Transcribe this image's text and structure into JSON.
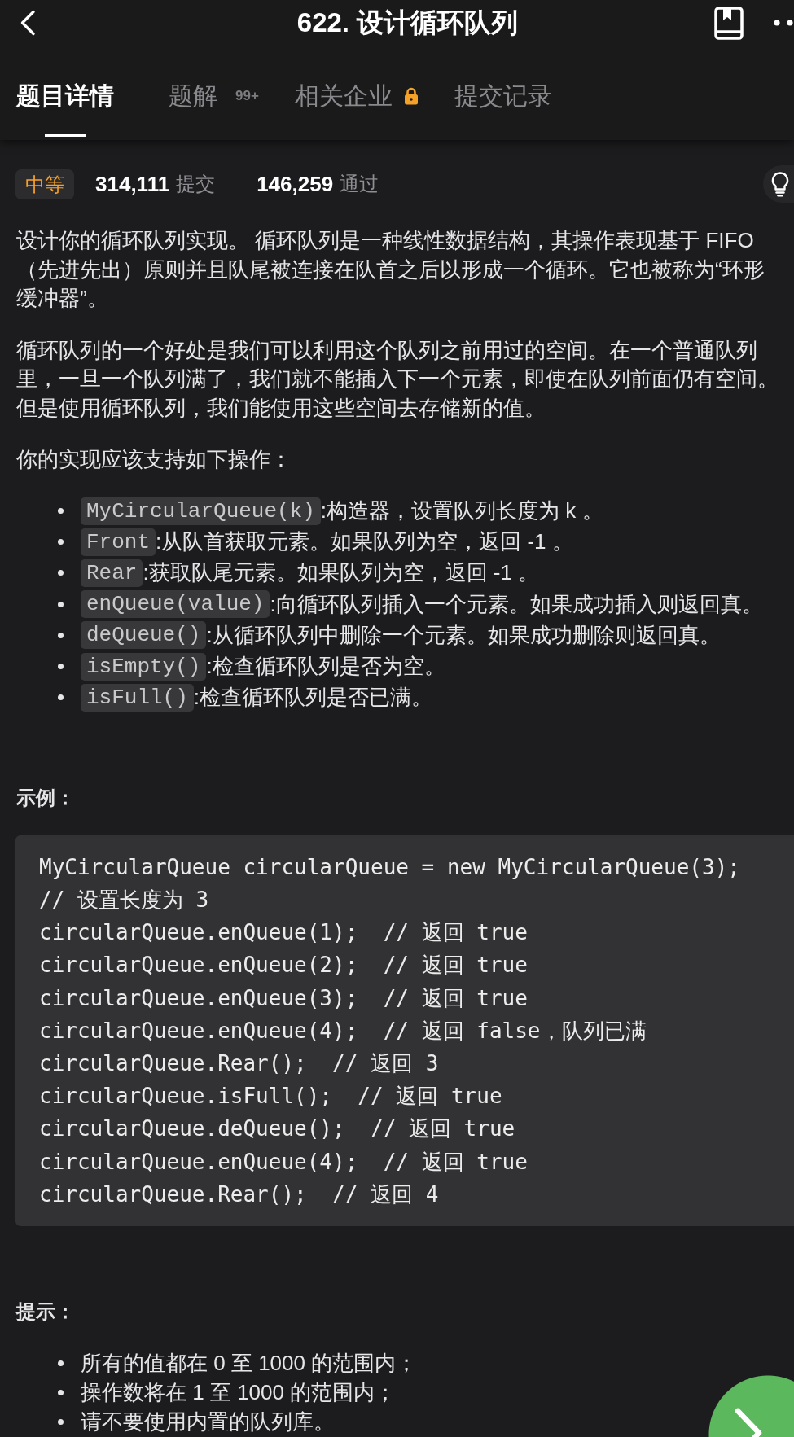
{
  "header": {
    "title": "622. 设计循环队列"
  },
  "tabs": [
    {
      "label": "题目详情",
      "selected": true,
      "locked": false
    },
    {
      "label": "题解",
      "badge": "99+",
      "selected": false,
      "locked": false
    },
    {
      "label": "相关企业",
      "selected": false,
      "locked": true
    },
    {
      "label": "提交记录",
      "selected": false,
      "locked": false
    }
  ],
  "stats": {
    "difficulty": {
      "label": "中等",
      "kind": "medium"
    },
    "submissions": {
      "value": "314,111",
      "label": "提交"
    },
    "accepted": {
      "value": "146,259",
      "label": "通过"
    }
  },
  "description": {
    "paragraphs": [
      "设计你的循环队列实现。 循环队列是一种线性数据结构，其操作表现基于 FIFO（先进先出）原则并且队尾被连接在队首之后以形成一个循环。它也被称为“环形缓冲器”。",
      "循环队列的一个好处是我们可以利用这个队列之前用过的空间。在一个普通队列里，一旦一个队列满了，我们就不能插入下一个元素，即使在队列前面仍有空间。但是使用循环队列，我们能使用这些空间去存储新的值。",
      "你的实现应该支持如下操作："
    ],
    "operations": [
      {
        "code": "MyCircularQueue(k)",
        "text": ":构造器，设置队列长度为 k 。"
      },
      {
        "code": "Front",
        "text": ":从队首获取元素。如果队列为空，返回 -1 。"
      },
      {
        "code": "Rear",
        "text": ":获取队尾元素。如果队列为空，返回 -1 。"
      },
      {
        "code": "enQueue(value)",
        "text": ":向循环队列插入一个元素。如果成功插入则返回真。"
      },
      {
        "code": "deQueue()",
        "text": ":从循环队列中删除一个元素。如果成功删除则返回真。"
      },
      {
        "code": "isEmpty()",
        "text": ":检查循环队列是否为空。"
      },
      {
        "code": "isFull()",
        "text": ":检查循环队列是否已满。"
      }
    ]
  },
  "example": {
    "heading": "示例：",
    "code_lines": [
      "MyCircularQueue circularQueue = new MyCircularQueue(3);",
      "// 设置长度为 3",
      "circularQueue.enQueue(1);  // 返回 true",
      "circularQueue.enQueue(2);  // 返回 true",
      "circularQueue.enQueue(3);  // 返回 true",
      "circularQueue.enQueue(4);  // 返回 false，队列已满",
      "circularQueue.Rear();  // 返回 3",
      "circularQueue.isFull();  // 返回 true",
      "circularQueue.deQueue();  // 返回 true",
      "circularQueue.enQueue(4);  // 返回 true",
      "circularQueue.Rear();  // 返回 4"
    ]
  },
  "hints": {
    "heading": "提示：",
    "items": [
      "所有的值都在 0 至 1000 的范围内；",
      "操作数将在 1 至 1000 的范围内；",
      "请不要使用内置的队列库。"
    ]
  }
}
